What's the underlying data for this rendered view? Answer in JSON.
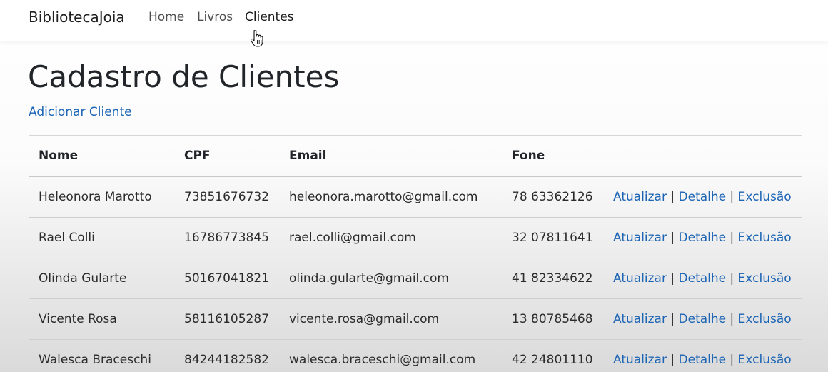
{
  "navbar": {
    "brand": "BibliotecaJoia",
    "links": [
      "Home",
      "Livros",
      "Clientes"
    ]
  },
  "page": {
    "title": "Cadastro de Clientes",
    "add_link": "Adicionar Cliente"
  },
  "table": {
    "headers": [
      "Nome",
      "CPF",
      "Email",
      "Fone",
      ""
    ],
    "action_labels": {
      "update": "Atualizar",
      "detail": "Detalhe",
      "delete": "Exclusão",
      "separator": "|"
    },
    "rows": [
      {
        "nome": "Heleonora Marotto",
        "cpf": "73851676732",
        "email": "heleonora.marotto@gmail.com",
        "fone": "78 63362126"
      },
      {
        "nome": "Rael Colli",
        "cpf": "16786773845",
        "email": "rael.colli@gmail.com",
        "fone": "32 07811641"
      },
      {
        "nome": "Olinda Gularte",
        "cpf": "50167041821",
        "email": "olinda.gularte@gmail.com",
        "fone": "41 82334622"
      },
      {
        "nome": "Vicente Rosa",
        "cpf": "58116105287",
        "email": "vicente.rosa@gmail.com",
        "fone": "13 80785468"
      },
      {
        "nome": "Walesca Braceschi",
        "cpf": "84244182582",
        "email": "walesca.braceschi@gmail.com",
        "fone": "42 24801110"
      }
    ]
  },
  "colors": {
    "link": "#1c64b4",
    "text": "#212529"
  },
  "icons": {
    "cursor": "hand-pointer-icon"
  }
}
